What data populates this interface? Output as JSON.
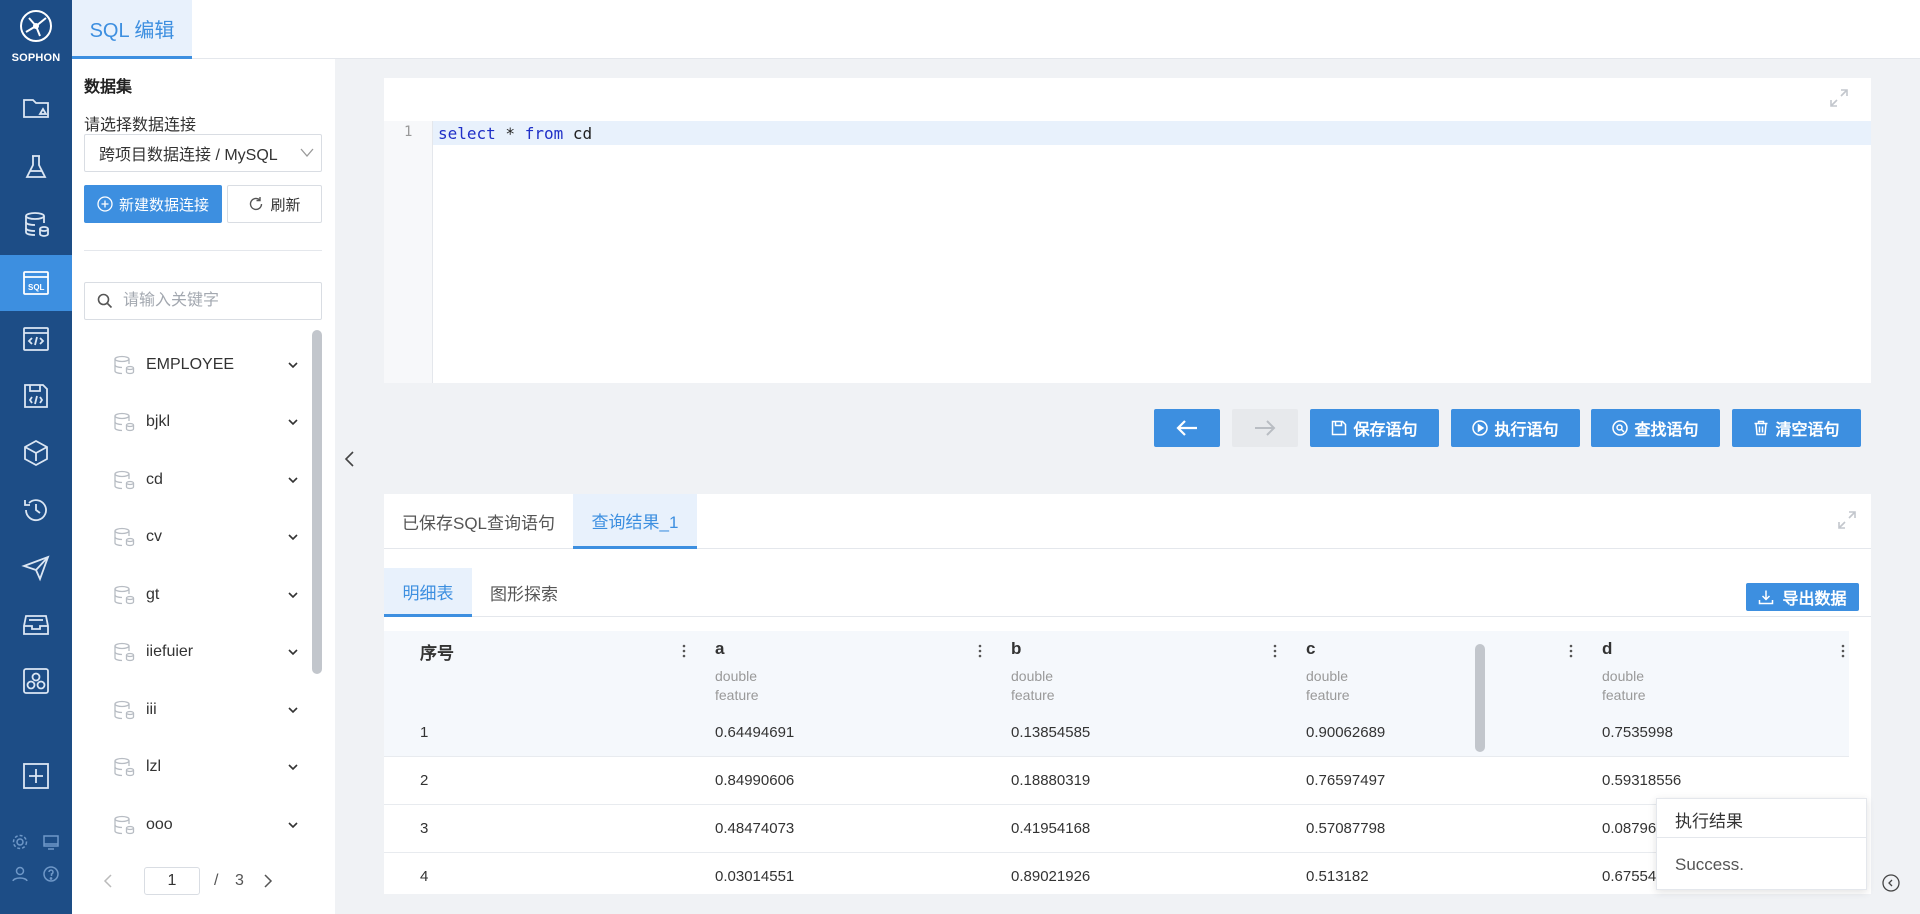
{
  "app": {
    "logo_text": "SOPHON"
  },
  "rail": {
    "items": [
      {
        "icon": "folder-icon"
      },
      {
        "icon": "flask-icon"
      },
      {
        "icon": "database-stack-icon"
      },
      {
        "icon": "sql-icon",
        "active": true
      },
      {
        "icon": "code-window-icon"
      },
      {
        "icon": "code-save-icon"
      },
      {
        "icon": "cube-icon"
      },
      {
        "icon": "history-icon"
      },
      {
        "icon": "send-icon"
      },
      {
        "icon": "inbox-icon"
      },
      {
        "icon": "cluster-icon"
      },
      {
        "icon": "plus-box-icon"
      }
    ],
    "bottom_icons": [
      "settings-icon",
      "monitor-icon",
      "user-icon",
      "help-icon"
    ]
  },
  "topbar": {
    "tab_label": "SQL 编辑"
  },
  "dataset_panel": {
    "title": "数据集",
    "select_label": "请选择数据连接",
    "select_value": "跨项目数据连接 / MySQL",
    "new_button": "新建数据连接",
    "refresh_button": "刷新",
    "search_placeholder": "请输入关键字",
    "items": [
      "EMPLOYEE",
      "bjkl",
      "cd",
      "cv",
      "gt",
      "iiefuier",
      "iii",
      "lzl",
      "ooo"
    ],
    "pager": {
      "current": "1",
      "slash": "/",
      "total": "3"
    }
  },
  "editor": {
    "line_number": "1",
    "code_tokens": {
      "kw1": "select",
      "mid": " * ",
      "kw2": "from",
      "rest": " cd"
    }
  },
  "toolbar": {
    "save": "保存语句",
    "run": "执行语句",
    "find": "查找语句",
    "clear": "清空语句"
  },
  "results": {
    "tabs": [
      "已保存SQL查询语句",
      "查询结果_1"
    ],
    "subtabs": [
      "明细表",
      "图形探索"
    ],
    "export_button": "导出数据",
    "columns": [
      {
        "name": "序号",
        "type": "",
        "role": ""
      },
      {
        "name": "a",
        "type": "double",
        "role": "feature"
      },
      {
        "name": "b",
        "type": "double",
        "role": "feature"
      },
      {
        "name": "c",
        "type": "double",
        "role": "feature"
      },
      {
        "name": "d",
        "type": "double",
        "role": "feature"
      }
    ],
    "rows": [
      [
        "1",
        "0.64494691",
        "0.13854585",
        "0.90062689",
        "0.7535998"
      ],
      [
        "2",
        "0.84990606",
        "0.18880319",
        "0.76597497",
        "0.59318556"
      ],
      [
        "3",
        "0.48474073",
        "0.41954168",
        "0.57087798",
        "0.08796"
      ],
      [
        "4",
        "0.03014551",
        "0.89021926",
        "0.513182",
        "0.67554"
      ]
    ]
  },
  "toast": {
    "title": "执行结果",
    "message": "Success."
  },
  "colors": {
    "rail": "#1d4d86",
    "accent": "#3d8fe0",
    "accent_light": "#e8f1fc"
  }
}
